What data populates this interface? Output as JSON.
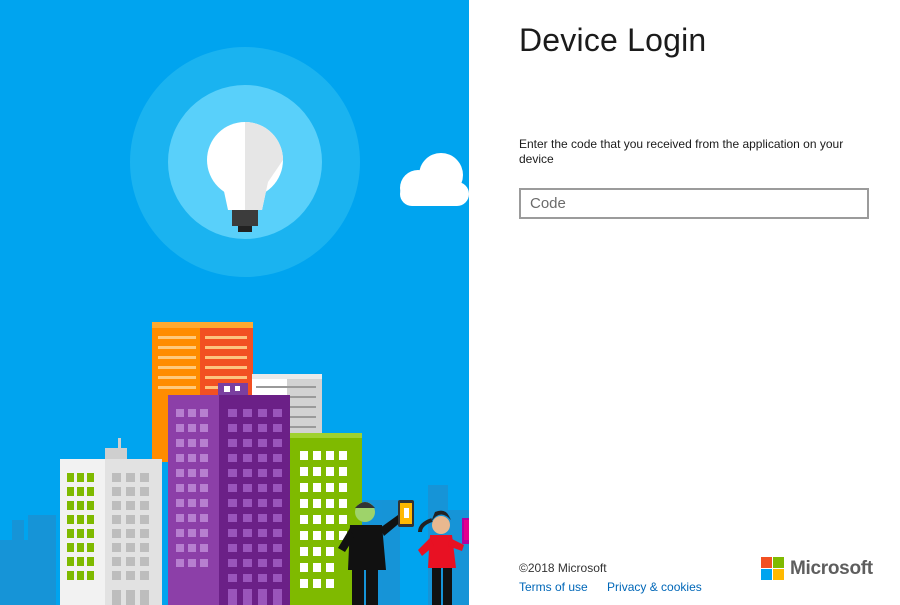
{
  "page": {
    "title": "Device Login"
  },
  "form": {
    "instruction": "Enter the code that you received from the application on your device",
    "code_placeholder": "Code"
  },
  "footer": {
    "copyright": "©2018 Microsoft",
    "terms_label": "Terms of use",
    "privacy_label": "Privacy & cookies",
    "brand": "Microsoft"
  },
  "colors": {
    "sky": "#00a4ef",
    "link": "#0067b8",
    "ms_red": "#f25022",
    "ms_green": "#7fba00",
    "ms_blue": "#00a4ef",
    "ms_yellow": "#ffb900"
  },
  "illustration": {
    "description": "city skyline with lightbulb and people holding devices",
    "icon": "lightbulb-icon"
  }
}
